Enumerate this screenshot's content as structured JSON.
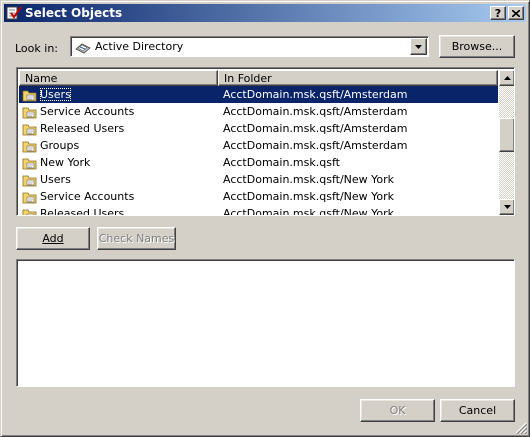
{
  "window": {
    "title": "Select Objects",
    "help_button": "?",
    "close_button": "X"
  },
  "look_in": {
    "label": "Look in:",
    "value": "Active Directory",
    "browse_label": "Browse..."
  },
  "objects_list": {
    "columns": [
      "Name",
      "In Folder"
    ],
    "rows": [
      {
        "name": "Users",
        "folder": "AcctDomain.msk.qsft/Amsterdam",
        "selected": true
      },
      {
        "name": "Service Accounts",
        "folder": "AcctDomain.msk.qsft/Amsterdam"
      },
      {
        "name": "Released Users",
        "folder": "AcctDomain.msk.qsft/Amsterdam"
      },
      {
        "name": "Groups",
        "folder": "AcctDomain.msk.qsft/Amsterdam"
      },
      {
        "name": "New York",
        "folder": "AcctDomain.msk.qsft"
      },
      {
        "name": "Users",
        "folder": "AcctDomain.msk.qsft/New York"
      },
      {
        "name": "Service Accounts",
        "folder": "AcctDomain.msk.qsft/New York"
      },
      {
        "name": "Released Users",
        "folder": "AcctDomain.msk.qsft/New York"
      }
    ]
  },
  "buttons": {
    "add": "Add",
    "check_names": "Check Names",
    "ok": "OK",
    "cancel": "Cancel"
  },
  "colors": {
    "title_bar": "#0a246a",
    "selection": "#0a246a",
    "face": "#d4d0c8"
  }
}
